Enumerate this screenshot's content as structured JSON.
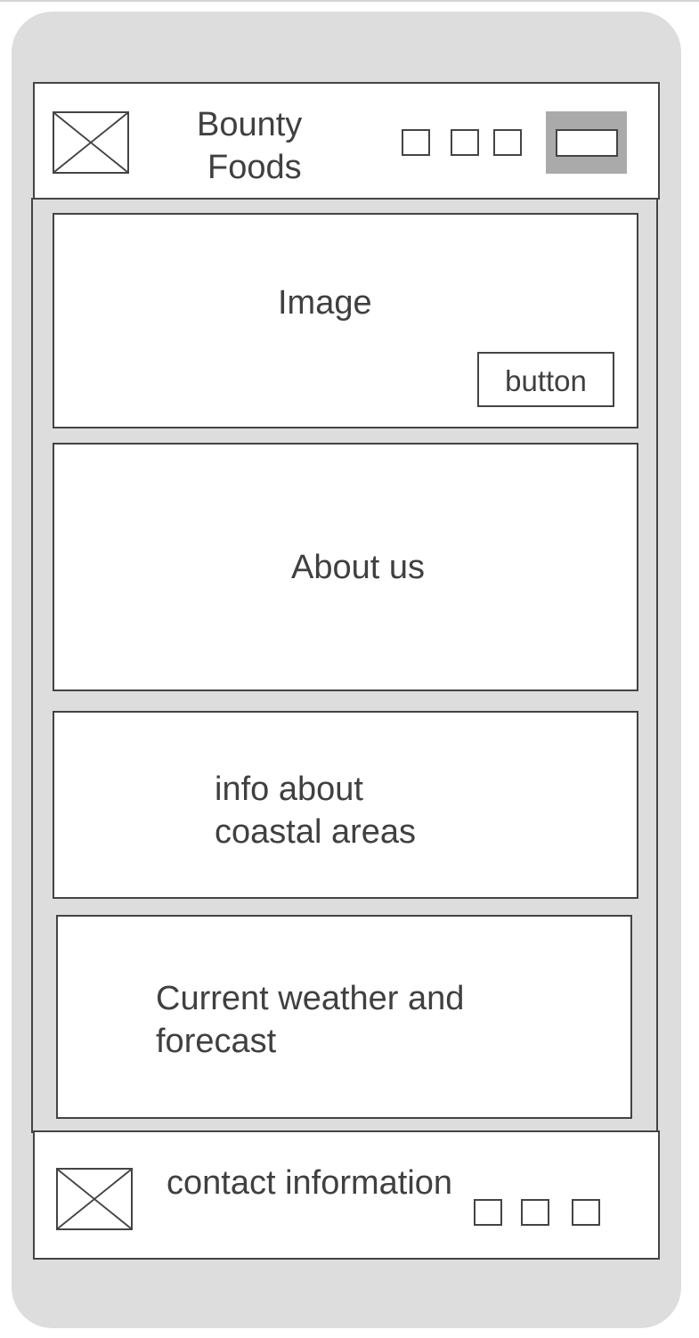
{
  "header": {
    "title_line1": "Bounty",
    "title_line2": "Foods",
    "logo_icon": "image-placeholder-icon",
    "nav_icons": [
      "nav-square-icon",
      "nav-square-icon",
      "nav-square-icon"
    ]
  },
  "hero": {
    "label": "Image",
    "button_label": "button"
  },
  "about": {
    "label": "About us"
  },
  "coastal": {
    "line1": "info about",
    "line2": "coastal areas"
  },
  "weather": {
    "line1": "Current weather and",
    "line2": "forecast"
  },
  "footer": {
    "label": "contact information",
    "logo_icon": "image-placeholder-icon",
    "social_icons": [
      "social-square-icon",
      "social-square-icon",
      "social-square-icon"
    ]
  },
  "colors": {
    "device_background": "#dddddd",
    "panel": "#ffffff",
    "border": "#444444",
    "menu_button": "#aaaaaa",
    "text": "#404040"
  }
}
